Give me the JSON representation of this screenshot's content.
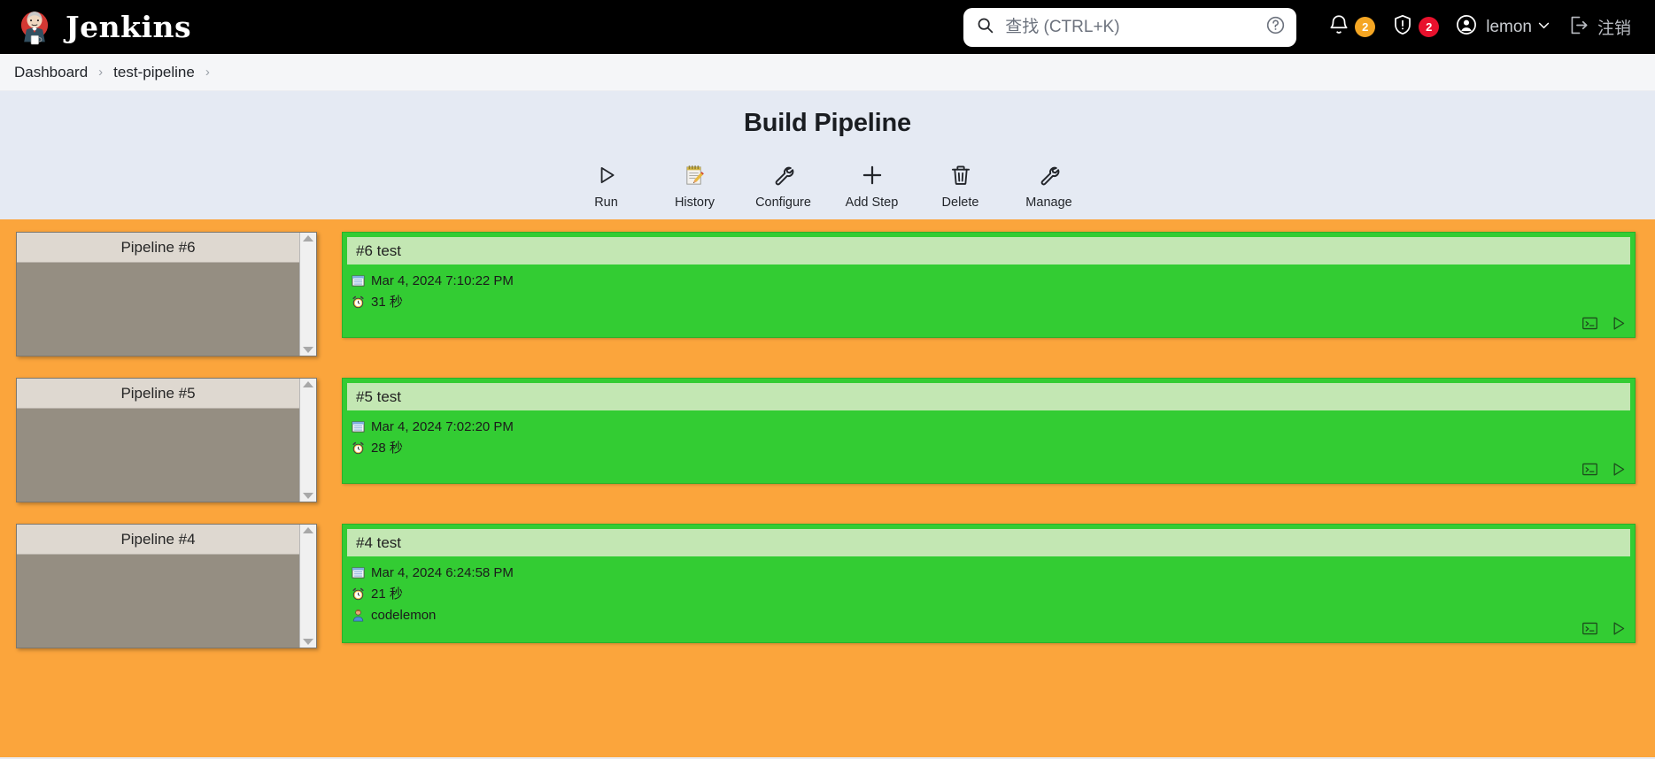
{
  "header": {
    "brand_name": "Jenkins",
    "brand_logo_icon": "jenkins-butler-logo",
    "search": {
      "icon": "search-icon",
      "placeholder": "查找 (CTRL+K)",
      "value": "",
      "help_icon": "help-circle-icon"
    },
    "notifications": {
      "icon": "bell-icon",
      "count": "2",
      "color": "#f5a623"
    },
    "security": {
      "icon": "shield-alert-icon",
      "count": "2",
      "color": "#e8112d"
    },
    "user": {
      "icon": "user-circle-icon",
      "name": "lemon",
      "chevron_icon": "chevron-down-icon"
    },
    "logout": {
      "icon": "logout-icon",
      "label": "注销"
    }
  },
  "breadcrumb": {
    "items": [
      {
        "label": "Dashboard"
      },
      {
        "label": "test-pipeline"
      }
    ],
    "separator": "›"
  },
  "main": {
    "title": "Build Pipeline",
    "toolbar": [
      {
        "label": "Run",
        "icon": "play-triangle-icon"
      },
      {
        "label": "History",
        "icon": "notepad-pencil-icon"
      },
      {
        "label": "Configure",
        "icon": "wrench-icon"
      },
      {
        "label": "Add Step",
        "icon": "plus-icon"
      },
      {
        "label": "Delete",
        "icon": "trash-icon"
      },
      {
        "label": "Manage",
        "icon": "wrench-icon"
      }
    ]
  },
  "colors": {
    "header_bg": "#000000",
    "page_bg": "#e5eaf3",
    "pipeline_bg": "#fba53c",
    "build_green": "#33cc33",
    "build_head_green": "#c3e7b3",
    "stage_header": "#ded8d0",
    "stage_body": "#958e82"
  },
  "pipelines": [
    {
      "stage_title": "Pipeline #6",
      "build": {
        "title": "#6 test",
        "timestamp": "Mar 4, 2024 7:10:22 PM",
        "duration": "31 秒",
        "user": null,
        "timestamp_icon": "calendar-icon",
        "duration_icon": "alarm-clock-icon",
        "user_icon": "person-icon",
        "actions": [
          {
            "icon": "console-output-icon"
          },
          {
            "icon": "play-triangle-icon"
          }
        ]
      }
    },
    {
      "stage_title": "Pipeline #5",
      "build": {
        "title": "#5 test",
        "timestamp": "Mar 4, 2024 7:02:20 PM",
        "duration": "28 秒",
        "user": null,
        "timestamp_icon": "calendar-icon",
        "duration_icon": "alarm-clock-icon",
        "user_icon": "person-icon",
        "actions": [
          {
            "icon": "console-output-icon"
          },
          {
            "icon": "play-triangle-icon"
          }
        ]
      }
    },
    {
      "stage_title": "Pipeline #4",
      "build": {
        "title": "#4 test",
        "timestamp": "Mar 4, 2024 6:24:58 PM",
        "duration": "21 秒",
        "user": "codelemon",
        "timestamp_icon": "calendar-icon",
        "duration_icon": "alarm-clock-icon",
        "user_icon": "person-icon",
        "actions": [
          {
            "icon": "console-output-icon"
          },
          {
            "icon": "play-triangle-icon"
          }
        ]
      }
    }
  ]
}
